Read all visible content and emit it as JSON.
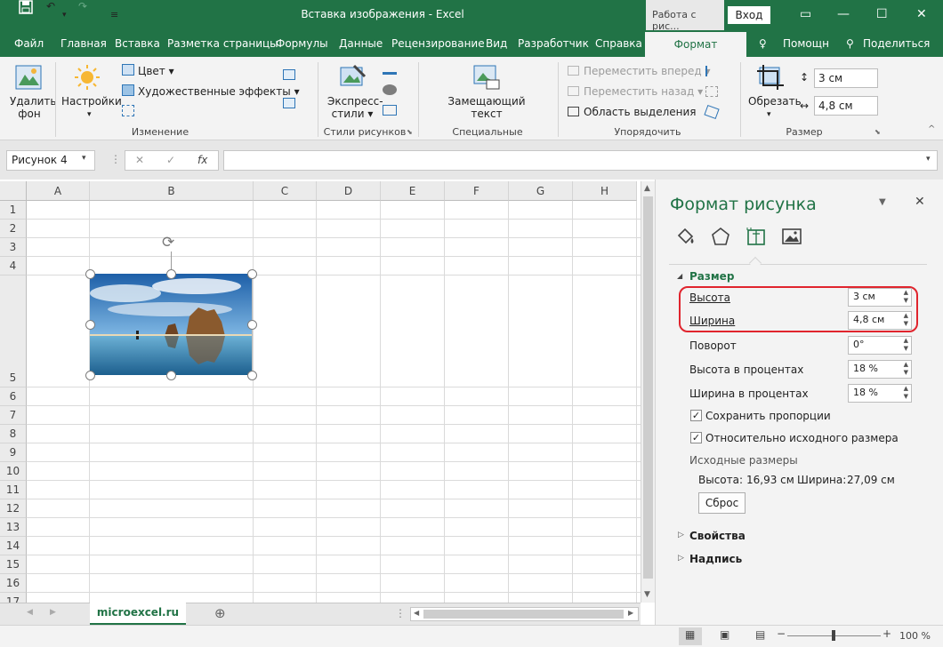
{
  "window": {
    "title": "Вставка изображения - Excel",
    "context_group": "Работа с рис...",
    "login": "Вход"
  },
  "tabs": [
    "Файл",
    "Главная",
    "Вставка",
    "Разметка страницы",
    "Формулы",
    "Данные",
    "Рецензирование",
    "Вид",
    "Разработчик",
    "Справка"
  ],
  "active_tab": "Формат",
  "help": "Помощн",
  "share": "Поделиться",
  "ribbon": {
    "remove_bg": [
      "Удалить",
      "фон"
    ],
    "corrections": "Настройки",
    "color": "Цвет",
    "artistic": "Художественные эффекты",
    "group_adjust": "Изменение",
    "quick_styles": [
      "Экспресс-",
      "стили"
    ],
    "group_styles": "Стили рисунков",
    "alt_text": [
      "Замещающий",
      "текст"
    ],
    "group_access": "Специальные возможности",
    "bring_forward": "Переместить вперед",
    "send_backward": "Переместить назад",
    "selection_pane": "Область выделения",
    "group_arrange": "Упорядочить",
    "crop": "Обрезать",
    "height": "3 см",
    "width": "4,8 см",
    "group_size": "Размер"
  },
  "namebox": "Рисунок 4",
  "fx": "fx",
  "columns": [
    "A",
    "B",
    "C",
    "D",
    "E",
    "F",
    "G",
    "H"
  ],
  "rows": [
    "1",
    "2",
    "3",
    "4",
    "5",
    "6",
    "7",
    "8",
    "9",
    "10",
    "11",
    "12",
    "13",
    "14",
    "15",
    "16",
    "17"
  ],
  "sheet": "microexcel.ru",
  "zoom": "100 %",
  "pane": {
    "title": "Формат рисунка",
    "section": "Размер",
    "height_label": "Высота",
    "height_value": "3 см",
    "width_label": "Ширина",
    "width_value": "4,8 см",
    "rotation_label": "Поворот",
    "rotation_value": "0°",
    "scale_h_label": "Высота в процентах",
    "scale_h_value": "18 %",
    "scale_w_label": "Ширина в процентах",
    "scale_w_value": "18 %",
    "lock_aspect": "Сохранить пропорции",
    "relative": "Относительно исходного размера",
    "original_title": "Исходные размеры",
    "orig_h_label": "Высота:",
    "orig_h_value": "16,93 см",
    "orig_w_label": "Ширина:",
    "orig_w_value": "27,09 см",
    "reset": "Сброс",
    "properties": "Свойства",
    "alt_text": "Надпись"
  },
  "colors": {
    "accent": "#217346",
    "highlight": "#e0242d"
  }
}
